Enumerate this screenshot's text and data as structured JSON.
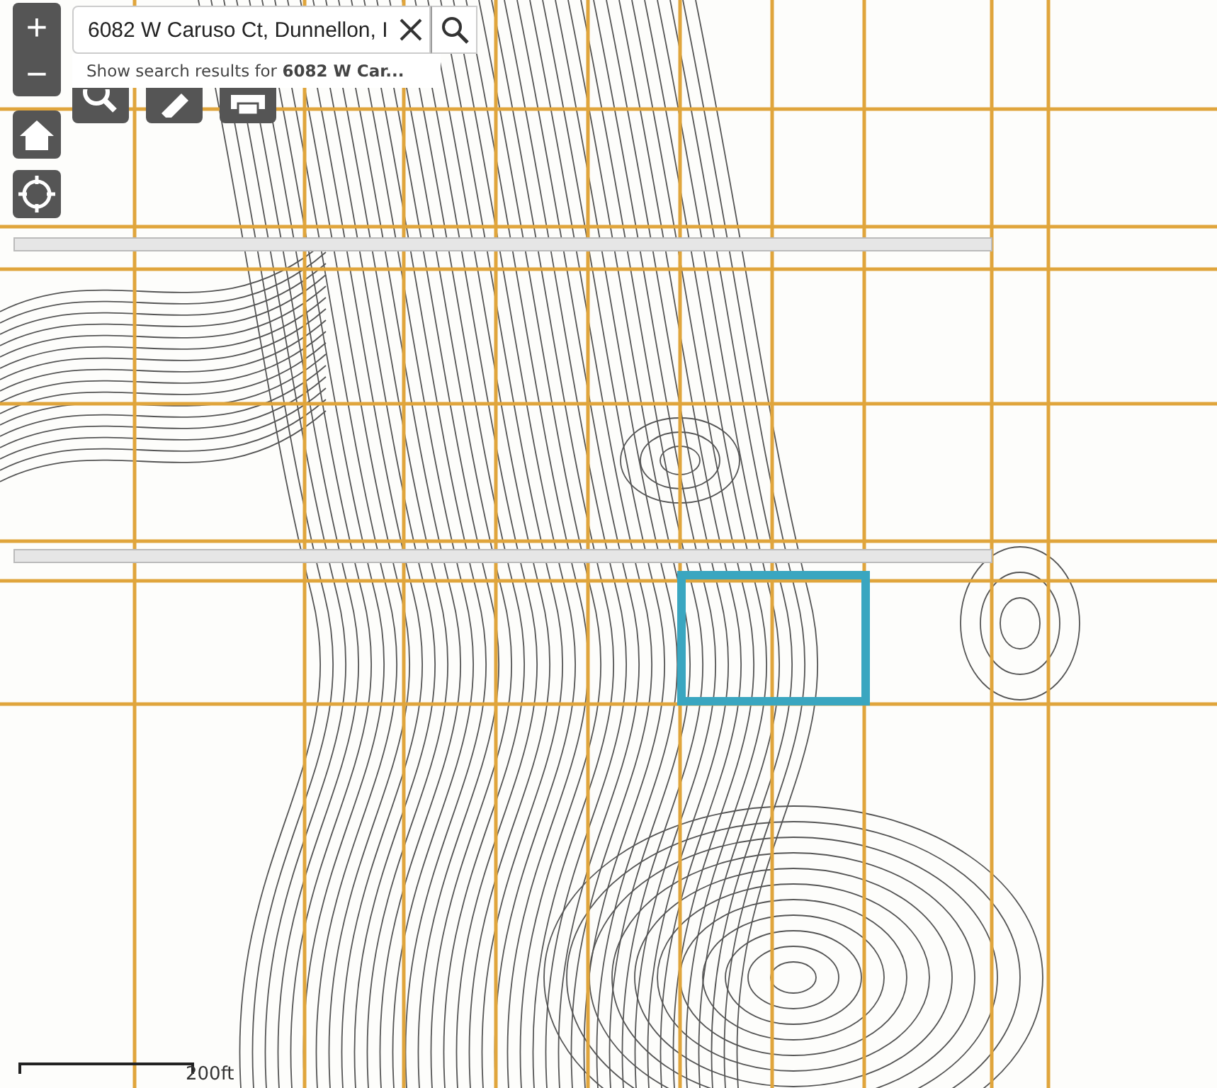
{
  "zoom_controls": {
    "zoom_in": "+",
    "zoom_out": "−"
  },
  "search": {
    "value": "6082 W Caruso Ct, Dunnellon, I",
    "suggestion": "Show search results for **6082 W Car...**"
  },
  "scale_bar": {
    "label": "200ft"
  }
}
